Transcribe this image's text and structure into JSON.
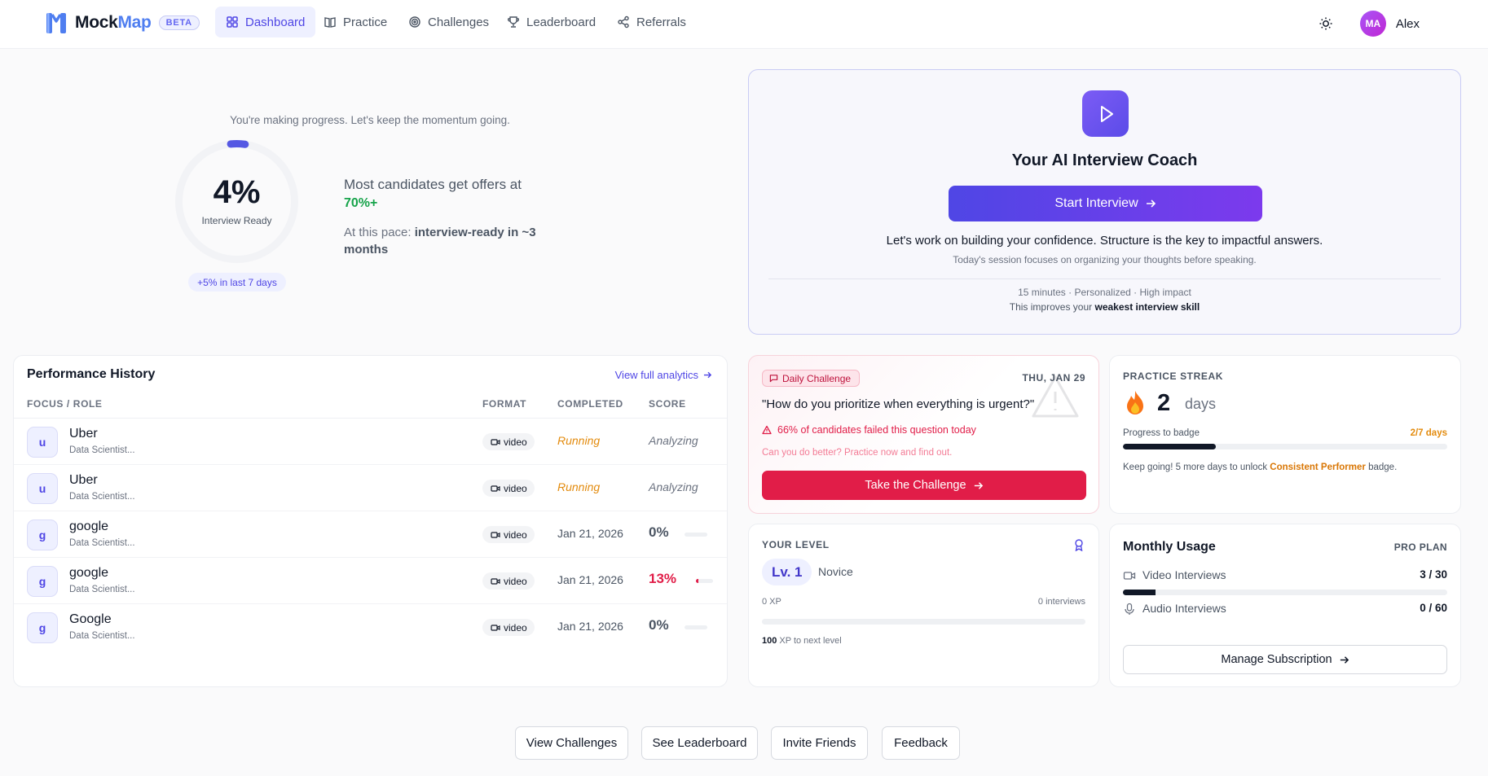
{
  "colors": {
    "brand": "#4f46e5",
    "accent_purple": "#7c3aed",
    "success": "#16a34a",
    "danger": "#e11d48",
    "warning": "#e38b0e"
  },
  "nav": {
    "logo_part1": "Mock",
    "logo_part2": "Map",
    "beta": "BETA",
    "items": [
      {
        "label": "Dashboard",
        "icon": "grid-icon",
        "active": true
      },
      {
        "label": "Practice",
        "icon": "book-icon"
      },
      {
        "label": "Challenges",
        "icon": "target-icon"
      },
      {
        "label": "Leaderboard",
        "icon": "trophy-icon"
      },
      {
        "label": "Referrals",
        "icon": "share-icon"
      }
    ],
    "theme_icon": "sun-icon",
    "user_initials": "MA",
    "user_name": "Alex"
  },
  "readiness": {
    "tagline": "You're making progress. Let's keep the momentum going.",
    "percent": 4,
    "percent_text": "4%",
    "label": "Interview Ready",
    "weekly_change": "+5% in last 7 days",
    "offers_text": "Most candidates get offers at",
    "offers_value": "70%+",
    "pace_prefix": "At this pace:",
    "pace_value": "interview-ready in ~3 months"
  },
  "coach": {
    "title": "Your AI Interview Coach",
    "button": "Start Interview",
    "message": "Let's work on building your confidence. Structure is the key to impactful answers.",
    "submessage": "Today's session focuses on organizing your thoughts before speaking.",
    "meta": "15 minutes · Personalized · High impact",
    "weak_prefix": "This improves your",
    "weak_value": "weakest interview skill"
  },
  "performance": {
    "title": "Performance History",
    "link": "View full analytics",
    "columns": {
      "focus": "FOCUS / ROLE",
      "format": "FORMAT",
      "completed": "COMPLETED",
      "score": "SCORE"
    },
    "rows": [
      {
        "initial": "u",
        "company": "Uber",
        "role": "Data Scientist...",
        "format": "video",
        "completed": "Running",
        "score": "Analyzing"
      },
      {
        "initial": "u",
        "company": "Uber",
        "role": "Data Scientist...",
        "format": "video",
        "completed": "Running",
        "score": "Analyzing"
      },
      {
        "initial": "g",
        "company": "google",
        "role": "Data Scientist...",
        "format": "video",
        "completed": "Jan 21, 2026",
        "score": "0%",
        "score_value": 0
      },
      {
        "initial": "g",
        "company": "google",
        "role": "Data Scientist...",
        "format": "video",
        "completed": "Jan 21, 2026",
        "score": "13%",
        "score_value": 13
      },
      {
        "initial": "g",
        "company": "Google",
        "role": "Data Scientist...",
        "format": "video",
        "completed": "Jan 21, 2026",
        "score": "0%",
        "score_value": 0
      }
    ]
  },
  "daily": {
    "tag": "Daily Challenge",
    "date": "THU, JAN 29",
    "question": "\"How do you prioritize when everything is urgent?\"",
    "failed": "66% of candidates failed this question today",
    "sub": "Can you do better? Practice now and find out.",
    "button": "Take the Challenge"
  },
  "streak": {
    "label": "PRACTICE STREAK",
    "count": "2",
    "unit": "days",
    "progress_label": "Progress to badge",
    "progress_text": "2/7 days",
    "progress_value": 2,
    "progress_total": 7,
    "note_prefix": "Keep going! 5 more days to unlock",
    "badge_name": "Consistent Performer",
    "note_suffix": "badge."
  },
  "level": {
    "label": "YOUR LEVEL",
    "badge": "Lv. 1",
    "name": "Novice",
    "xp": "0 XP",
    "interviews": "0 interviews",
    "next_value": "100",
    "next_text": "XP to next level",
    "progress": 0
  },
  "usage": {
    "title": "Monthly Usage",
    "plan": "PRO PLAN",
    "video_label": "Video Interviews",
    "video_count": "3 / 30",
    "video_used": 3,
    "video_total": 30,
    "audio_label": "Audio Interviews",
    "audio_count": "0 / 60",
    "button": "Manage Subscription"
  },
  "footer": {
    "view_challenges": "View Challenges",
    "see_leaderboard": "See Leaderboard",
    "invite_friends": "Invite Friends",
    "feedback": "Feedback"
  }
}
